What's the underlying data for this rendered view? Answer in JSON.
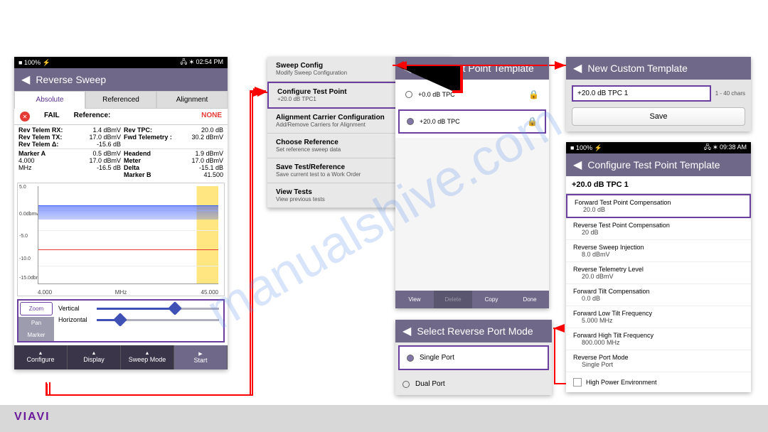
{
  "footer_logo": "VIAVI",
  "watermark": "manualshive.com",
  "panelA": {
    "status_left": "■ 100% ⚡",
    "status_right": "🖧 ✶ 02:54 PM",
    "title": "Reverse Sweep",
    "tabs": {
      "absolute": "Absolute",
      "referenced": "Referenced",
      "alignment": "Alignment"
    },
    "fail": "FAIL",
    "reference_label": "Reference:",
    "reference_value": "NONE",
    "telem": {
      "rx_l": "Rev Telem RX:",
      "rx_v": "1.4 dBmV",
      "tpc_l": "Rev TPC:",
      "tpc_v": "20.0 dB",
      "tx_l": "Rev Telem TX:",
      "tx_v": "17.0 dBmV",
      "fwd_l": "Fwd Telemetry :",
      "fwd_v": "30.2 dBmV",
      "delta_l": "Rev Telem Δ:",
      "delta_v": "-15.6 dB"
    },
    "markers": {
      "a_l": "Marker A",
      "a_v": "0.5 dBmV",
      "h_l": "Headend",
      "h_v": "1.9 dBmV",
      "b_l": "Marker B",
      "b_v": "",
      "af_l": "4.000",
      "af_v": "17.0 dBmV",
      "m_l": "Meter",
      "m_v": "17.0 dBmV",
      "bf_l": "41.500",
      "mhz": "MHz",
      "g": "-16.5 dB",
      "d_l": "Delta",
      "d_v": "-15.1 dB"
    },
    "chart": {
      "y0": "5.0",
      "y1": "0.0dbmv",
      "y2": "-5.0",
      "y3": "-10.0",
      "y4": "-15.0dbmv",
      "x0": "4.000",
      "xlabel": "MHz",
      "x1": "45.000"
    },
    "controls": {
      "zoom": "Zoom",
      "pan": "Pan",
      "marker": "Marker",
      "vertical": "Vertical",
      "horizontal": "Horizontal"
    },
    "nav": {
      "configure": "Configure",
      "display": "Display",
      "sweep": "Sweep Mode",
      "start": "Start"
    }
  },
  "panelB": {
    "items": [
      {
        "title": "Sweep Config",
        "sub": "Modify Sweep Configuration"
      },
      {
        "title": "Configure Test Point",
        "sub": "+20.0 dB TPC1"
      },
      {
        "title": "Alignment Carrier Configuration",
        "sub": "Add/Remove Carriers for Alignment"
      },
      {
        "title": "Choose Reference",
        "sub": "Set reference sweep data"
      },
      {
        "title": "Save Test/Reference",
        "sub": "Save current test to a Work Order"
      },
      {
        "title": "View Tests",
        "sub": "View previous tests"
      }
    ]
  },
  "panelC": {
    "title": "Select Test Point Template",
    "opts": [
      {
        "label": "+0.0 dB TPC"
      },
      {
        "label": "+20.0 dB TPC"
      }
    ],
    "actions": {
      "view": "View",
      "delete": "Delete",
      "copy": "Copy",
      "done": "Done"
    }
  },
  "panelD": {
    "title": "New Custom Template",
    "input_value": "+20.0 dB TPC 1",
    "chars": "1 - 40 chars",
    "save": "Save"
  },
  "panelE": {
    "status_left": "■ 100% ⚡",
    "status_right": "🖧 ✶ 09:38 AM",
    "title": "Configure Test Point Template",
    "header": "+20.0 dB TPC 1",
    "items": [
      {
        "title": "Forward Test Point Compensation",
        "val": "20.0 dB"
      },
      {
        "title": "Reverse Test Point Compensation",
        "val": "20 dB"
      },
      {
        "title": "Reverse Sweep Injection",
        "val": "8.0 dBmV"
      },
      {
        "title": "Reverse Telemetry Level",
        "val": "20.0 dBmV"
      },
      {
        "title": "Forward Tilt Compensation",
        "val": "0.0 dB"
      },
      {
        "title": "Forward Low Tilt Frequency",
        "val": "5.000 MHz"
      },
      {
        "title": "Forward High Tilt Frequency",
        "val": "800.000 MHz"
      },
      {
        "title": "Reverse Port Mode",
        "val": "Single Port"
      }
    ],
    "checkbox": "High Power Environment"
  },
  "panelF": {
    "title": "Select Reverse Port Mode",
    "single": "Single Port",
    "dual": "Dual Port"
  }
}
